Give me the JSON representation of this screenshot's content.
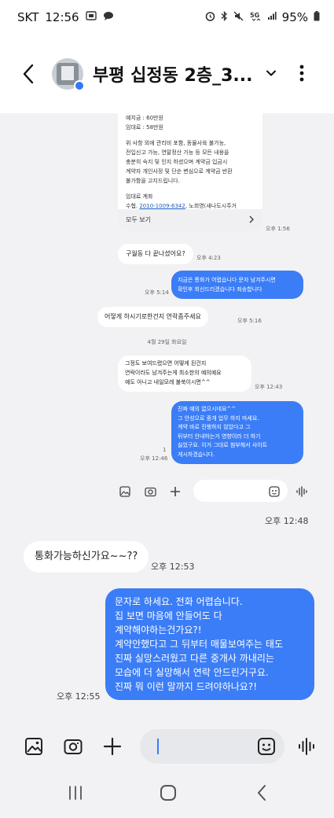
{
  "status_bar": {
    "carrier": "SKT",
    "time": "12:56",
    "battery": "95%",
    "icons": [
      "sim-icon",
      "chat-bubble-icon",
      "alarm-icon",
      "bluetooth-icon",
      "mute-icon",
      "5g-icon",
      "signal-icon",
      "battery-icon"
    ]
  },
  "header": {
    "contact_name": "부평 십정동 2층_3...",
    "back_icon": "chevron-left-icon",
    "expand_icon": "chevron-down-icon",
    "more_icon": "more-vertical-icon"
  },
  "messages": {
    "card": {
      "lines_a": [
        "예치금 : 60만원",
        "임대료 : 58만원"
      ],
      "lines_b": [
        "위 사항 외에 관리비 포함, 동물사육 불가능,",
        "전입신고 가능, 연말정산 가능 등 모든 내용을",
        "충분히 숙지 및 인지 하셨으며 계약금 입금시",
        "계약자 개인사정 및 단순 변심으로 계약금 반환",
        "불가함을 고지드립니다."
      ],
      "account_label": "임대료 계좌",
      "account_prefix": "수협.",
      "account_number": "2010-1009-6342",
      "account_suffix": ", 노희영(새나도시주거",
      "see_all": "모두 보기",
      "time": "오후 1:56"
    },
    "m1": {
      "text": "구월동 다 끝나셨어요?",
      "time": "오후 4:23"
    },
    "m2": {
      "lines": [
        "지금은 통화가 어렵습니다 문자 남겨주시면",
        "확인후 회신드리겠습니다 죄송합니다"
      ],
      "time": "오후 5:14"
    },
    "m3": {
      "text": "어떻게 하시기로한건지 연락좀주세요",
      "time": "오후 5:16"
    },
    "date_separator": "4월 29일 화요일",
    "m4": {
      "lines": [
        "그정도 보여드렸으면 어떻게 된건지",
        "연락이라도 남겨주는게 최소한의 예의예요",
        "예도 아니고 내일모레 불쑥이시면^^"
      ],
      "time": "오후 12:43"
    },
    "m5": {
      "lines": [
        "진짜 예의 없으시네요^^",
        "그 안성으로 중개 업무 하지 마세요.",
        "계약 바로 진행하지 않았다고 그",
        "뒤부터 안내하는거 영향이라 더 하기",
        "싫었구요. 이거 그대로 첨부해서 사이트",
        "게시하겠습니다."
      ],
      "unread": "1",
      "time": "오후 12:46"
    },
    "time_1248": "오후 12:48",
    "m6": {
      "text": "통화가능하신가요~~??",
      "time": "오후 12:53"
    },
    "m7": {
      "lines": [
        "문자로 하세요. 전화 어렵습니다.",
        "집 보면 마음에 안들어도 다",
        "계약해야하는건가요?!",
        "계약안했다고 그 뒤부터 매물보여주는 태도",
        "진짜 실망스러웠고 다른 중개사 까내리는",
        "모습에 더 실망해서 연락 안드린거구요.",
        "진짜 뭐 이런 말까지 드려야하나요?!"
      ],
      "time": "오후 12:55"
    }
  },
  "composer": {
    "gallery_icon": "gallery-icon",
    "camera_icon": "camera-icon",
    "add_icon": "plus-icon",
    "sticker_icon": "sticker-icon",
    "voice_icon": "voice-wave-icon",
    "input_value": ""
  },
  "nav_bar": {
    "recents_icon": "recents-icon",
    "home_icon": "home-icon",
    "back_icon": "back-icon"
  },
  "colors": {
    "outgoing_bubble": "#3b7df6",
    "incoming_bubble": "#ffffff",
    "background": "#f2f2f4",
    "accent": "#3478f6"
  }
}
